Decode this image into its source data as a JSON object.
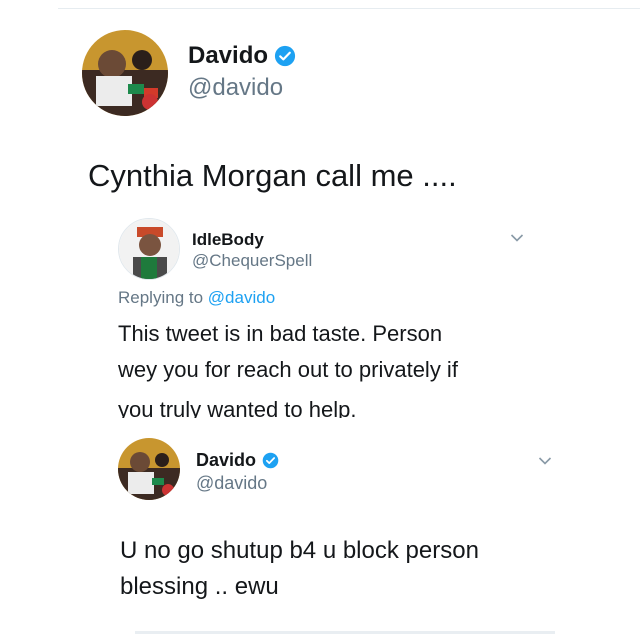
{
  "colors": {
    "accent": "#1da1f2",
    "text": "#14171a",
    "muted": "#657786"
  },
  "main_tweet": {
    "name": "Davido",
    "handle": "@davido",
    "verified": true,
    "text": "Cynthia Morgan call me ...."
  },
  "reply": {
    "name": "IdleBody",
    "handle": "@ChequerSpell",
    "replying_prefix": "Replying to",
    "replying_to": "@davido",
    "text_lines": [
      "This tweet is in bad taste. Person",
      "wey you for reach out to privately if",
      "you truly wanted to help."
    ]
  },
  "second_reply": {
    "name": "Davido",
    "handle": "@davido",
    "verified": true,
    "text_lines": [
      "U no go shutup b4 u block person",
      "blessing .. ewu"
    ]
  },
  "icons": [
    "verified-badge-icon",
    "chevron-down-icon"
  ]
}
